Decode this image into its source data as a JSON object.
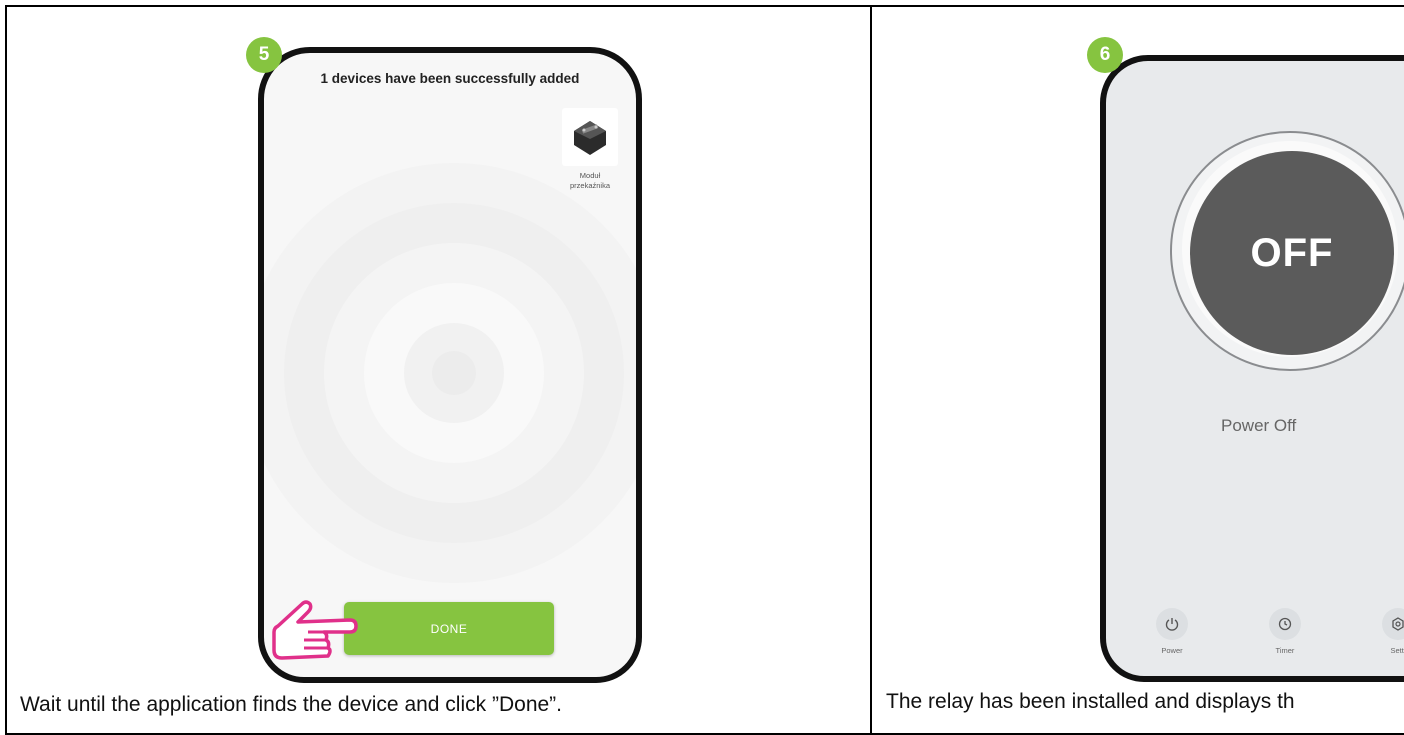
{
  "step5": {
    "badge": "5",
    "title": "1 devices have been successfully added",
    "device_label_line1": "Moduł",
    "device_label_line2": "przekaźnika",
    "done_label": "DONE",
    "caption": "Wait until the application finds the device and click ”Done”."
  },
  "step6": {
    "badge": "6",
    "power_state": "OFF",
    "status_text": "Power Off",
    "actions": [
      {
        "label": "Power",
        "icon": "power-icon"
      },
      {
        "label": "Timer",
        "icon": "timer-icon"
      },
      {
        "label": "Setti",
        "icon": "settings-icon"
      }
    ],
    "caption": "The relay has been installed and displays th"
  },
  "colors": {
    "accent_green": "#86c440",
    "off_circle": "#5b5b5b",
    "hand_pink": "#e0308a"
  }
}
